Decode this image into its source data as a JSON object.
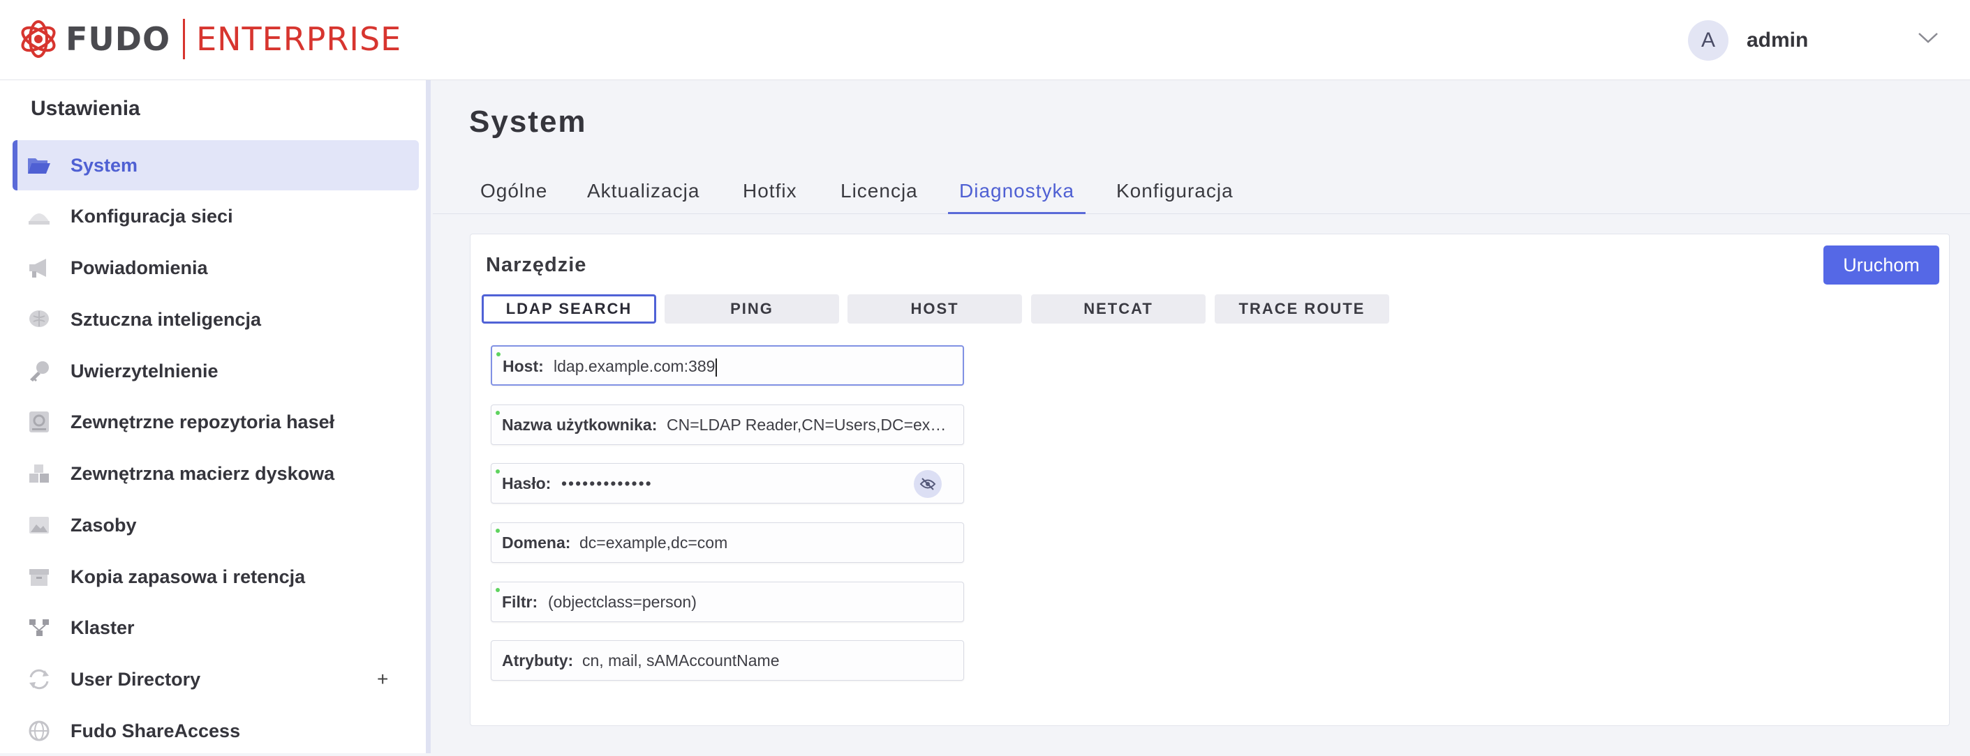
{
  "header": {
    "logo_brand": "FUDO",
    "logo_product": "ENTERPRISE",
    "avatar_initial": "A",
    "username": "admin",
    "colors": {
      "brand_red": "#d7352f",
      "accent": "#5568e6"
    }
  },
  "sidebar": {
    "title": "Ustawienia",
    "items": [
      {
        "label": "System",
        "icon": "folder-open-icon",
        "active": true
      },
      {
        "label": "Konfiguracja sieci",
        "icon": "network-icon"
      },
      {
        "label": "Powiadomienia",
        "icon": "megaphone-icon"
      },
      {
        "label": "Sztuczna inteligencja",
        "icon": "brain-icon"
      },
      {
        "label": "Uwierzytelnienie",
        "icon": "key-icon"
      },
      {
        "label": "Zewnętrzne repozytoria haseł",
        "icon": "vault-icon"
      },
      {
        "label": "Zewnętrzna macierz dyskowa",
        "icon": "boxes-icon"
      },
      {
        "label": "Zasoby",
        "icon": "image-icon"
      },
      {
        "label": "Kopia zapasowa i retencja",
        "icon": "archive-box-icon"
      },
      {
        "label": "Klaster",
        "icon": "cluster-icon"
      },
      {
        "label": "User Directory",
        "icon": "sync-icon",
        "expandable": "+"
      },
      {
        "label": "Fudo ShareAccess",
        "icon": "share-icon"
      }
    ]
  },
  "main": {
    "title": "System",
    "tabs": [
      {
        "label": "Ogólne"
      },
      {
        "label": "Aktualizacja"
      },
      {
        "label": "Hotfix"
      },
      {
        "label": "Licencja"
      },
      {
        "label": "Diagnostyka",
        "active": true
      },
      {
        "label": "Konfiguracja"
      }
    ],
    "tool": {
      "title": "Narzędzie",
      "run_label": "Uruchom",
      "buttons": [
        {
          "label": "LDAP SEARCH",
          "active": true
        },
        {
          "label": "PING"
        },
        {
          "label": "HOST"
        },
        {
          "label": "NETCAT"
        },
        {
          "label": "TRACE ROUTE"
        }
      ],
      "fields": {
        "host": {
          "label": "Host:",
          "value": "ldap.example.com:389"
        },
        "username": {
          "label": "Nazwa użytkownika:",
          "value": "CN=LDAP Reader,CN=Users,DC=example,DC=com"
        },
        "password": {
          "label": "Hasło:",
          "value": "•••••••••••••"
        },
        "domain": {
          "label": "Domena:",
          "value": "dc=example,dc=com"
        },
        "filter": {
          "label": "Filtr:",
          "value": "(objectclass=person)"
        },
        "attributes": {
          "label": "Atrybuty:",
          "value": "cn, mail, sAMAccountName"
        }
      }
    }
  }
}
